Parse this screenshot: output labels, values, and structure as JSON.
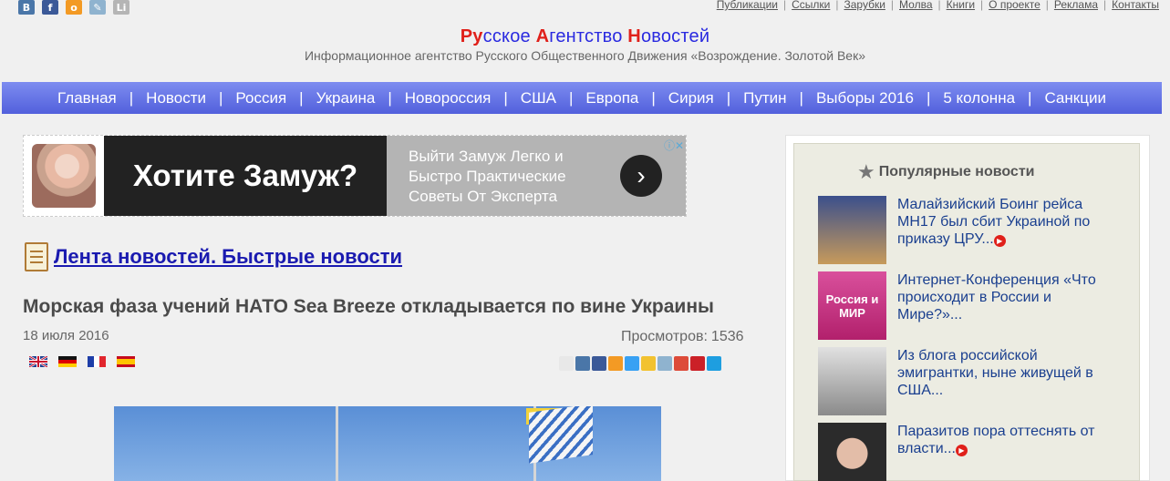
{
  "social": [
    {
      "icon": "vkontakte-icon",
      "glyph": "B",
      "color": "#4a76a8"
    },
    {
      "icon": "facebook-icon",
      "glyph": "f",
      "color": "#3b5998"
    },
    {
      "icon": "odnoklassniki-icon",
      "glyph": "o",
      "color": "#f39a24"
    },
    {
      "icon": "livejournal-icon",
      "glyph": "✎",
      "color": "#8fb3cf"
    },
    {
      "icon": "liveinternet-icon",
      "glyph": "Li",
      "color": "#b5b5b5"
    }
  ],
  "toplinks": [
    "Публикации",
    "Ссылки",
    "Зарубки",
    "Молва",
    "Книги",
    "О проекте",
    "Реклама",
    "Контакты"
  ],
  "brand": {
    "title_parts": [
      {
        "text": "Ру",
        "red": true
      },
      {
        "text": "сское ",
        "red": false
      },
      {
        "text": "А",
        "red": true
      },
      {
        "text": "гентство ",
        "red": false
      },
      {
        "text": "Н",
        "red": true
      },
      {
        "text": "овостей",
        "red": false
      }
    ],
    "subtitle": "Информационное агентство Русского Общественного Движения «Возрождение. Золотой Век»"
  },
  "nav": [
    "Главная",
    "Новости",
    "Россия",
    "Украина",
    "Новороссия",
    "США",
    "Европа",
    "Сирия",
    "Путин",
    "Выборы 2016",
    "5 колонна",
    "Санкции"
  ],
  "ad": {
    "headline": "Хотите Замуж?",
    "text": "Выйти Замуж Легко и Быстро Практические Советы От Эксперта",
    "arrow": "›",
    "info": "ⓘ✕"
  },
  "feed": {
    "label": "Лента новостей. Быстрые новости"
  },
  "article": {
    "title": "Морская фаза учений НАТО Sea Breeze откладывается по вине Украины",
    "date": "18 июля 2016",
    "views_label": "Просмотров:",
    "views_value": "1536",
    "flags": [
      "flag-uk-icon",
      "flag-de-icon",
      "flag-fr-icon",
      "flag-es-icon"
    ],
    "share": [
      {
        "icon": "share-print-icon",
        "color": "#e8e8e8"
      },
      {
        "icon": "share-vk-icon",
        "color": "#4a76a8"
      },
      {
        "icon": "share-facebook-icon",
        "color": "#3b5998"
      },
      {
        "icon": "share-odnoklassniki-icon",
        "color": "#f39a24"
      },
      {
        "icon": "share-twitter-icon",
        "color": "#38a1f3"
      },
      {
        "icon": "share-mail-icon",
        "color": "#f2c230"
      },
      {
        "icon": "share-livejournal-icon",
        "color": "#8fb3cf"
      },
      {
        "icon": "share-googleplus-icon",
        "color": "#dd4b39"
      },
      {
        "icon": "share-pinterest-icon",
        "color": "#cb2027"
      },
      {
        "icon": "share-surfingbird-icon",
        "color": "#1e9ee0"
      }
    ]
  },
  "sidebar": {
    "title": "Популярные новости",
    "items": [
      {
        "text": "Малайзийский Боинг рейса МН17 был сбит Украиной по приказу ЦРУ...",
        "play": true
      },
      {
        "text": "Интернет-Конференция «Что происходит в России и Мире?»...",
        "play": false,
        "thumb_text": "Россия и МИР"
      },
      {
        "text": "Из блога российской эмигрантки, ныне живущей в США...",
        "play": false
      },
      {
        "text": "Паразитов пора оттеснять от власти...",
        "play": true
      }
    ]
  }
}
